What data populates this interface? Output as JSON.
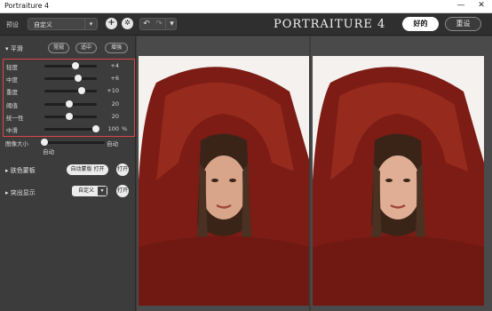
{
  "window": {
    "title": "Portraiture 4",
    "minimize": "—",
    "close": "✕"
  },
  "toolbar": {
    "preset_label": "预设",
    "preset_value": "自定义",
    "add_icon": "plus-icon",
    "settings_icon": "gear-icon",
    "undo_icon": "undo-icon",
    "redo_icon": "redo-icon",
    "brand": "PORTRAITURE 4",
    "ok_label": "好的",
    "reset_label": "重设"
  },
  "smoothing": {
    "header": "平滑",
    "modes": [
      "常规",
      "适中",
      "增强"
    ],
    "sliders": [
      {
        "label": "轻度",
        "value": "+4",
        "unit": "",
        "fraction": 0.6
      },
      {
        "label": "中度",
        "value": "+6",
        "unit": "",
        "fraction": 0.64
      },
      {
        "label": "重度",
        "value": "+10",
        "unit": "",
        "fraction": 0.72
      },
      {
        "label": "阈值",
        "value": "20",
        "unit": "",
        "fraction": 0.48
      },
      {
        "label": "统一性",
        "value": "20",
        "unit": "",
        "fraction": 0.48
      },
      {
        "label": "中滑",
        "value": "100",
        "unit": "%",
        "fraction": 0.98
      }
    ],
    "image_size_label": "图像大小",
    "image_size_value": "自动",
    "image_size_fraction": 0.0,
    "auto_below": "自动"
  },
  "skin_mask": {
    "header": "肤色蒙板",
    "toggle_label": "自动蒙版 打开",
    "open_label": "打开"
  },
  "enhance": {
    "header": "突出显示",
    "select_value": "自定义",
    "open_label": "打开"
  },
  "colors": {
    "panel": "#3c3c3c",
    "highlight": "#e04545",
    "sweater": "#8a1f17"
  }
}
